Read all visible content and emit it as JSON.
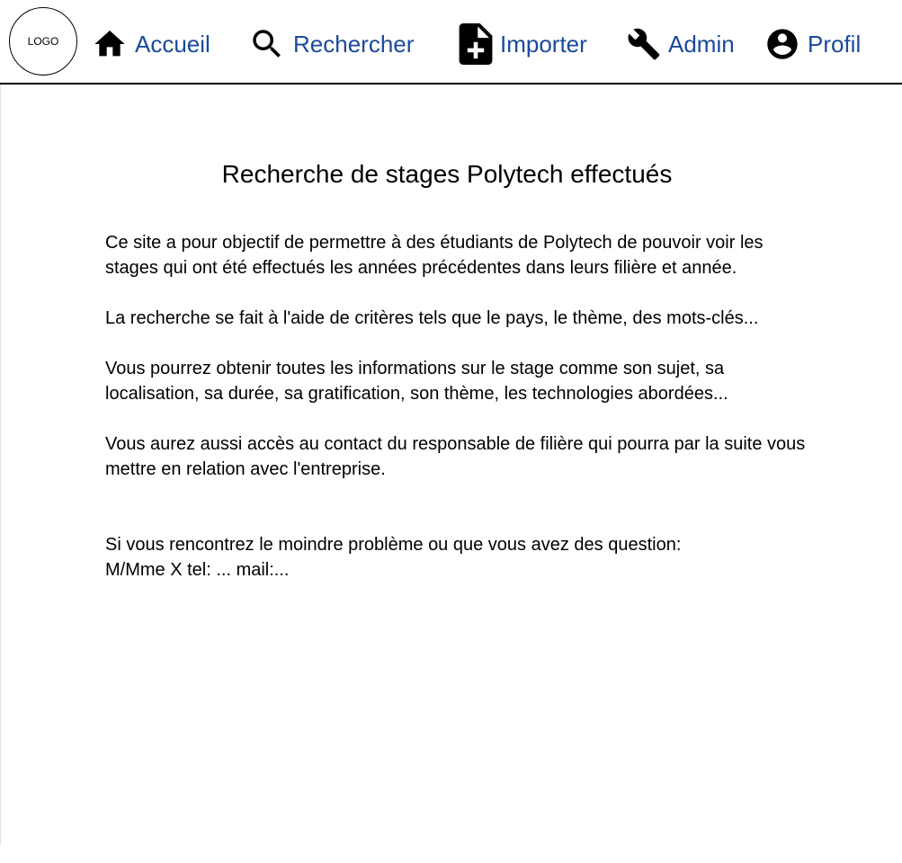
{
  "logo": {
    "text": "LOGO"
  },
  "nav": {
    "items": [
      {
        "label": "Accueil",
        "icon": "home-icon"
      },
      {
        "label": "Rechercher",
        "icon": "search-icon"
      },
      {
        "label": "Importer",
        "icon": "file-add-icon"
      },
      {
        "label": "Admin",
        "icon": "wrench-icon"
      },
      {
        "label": "Profil",
        "icon": "account-circle-icon"
      }
    ],
    "link_color": "#1a4a9c"
  },
  "main": {
    "title": "Recherche de stages Polytech effectués",
    "paragraphs": [
      "Ce site a pour objectif de permettre à des étudiants de Polytech de pouvoir voir les stages qui ont été effectués les années précédentes dans leurs filière et année.",
      "La recherche se fait à l'aide de critères tels que le pays, le thème, des mots-clés...",
      "Vous pourrez obtenir toutes les informations sur le stage comme son sujet, sa localisation, sa durée, sa gratification, son thème, les technologies abordées...",
      "Vous aurez aussi accès au contact du responsable de filière qui pourra par la suite vous mettre en relation avec l'entreprise."
    ],
    "contact_line1": "Si vous rencontrez le moindre problème ou que vous avez des question:",
    "contact_line2": "M/Mme X tel: ... mail:..."
  }
}
